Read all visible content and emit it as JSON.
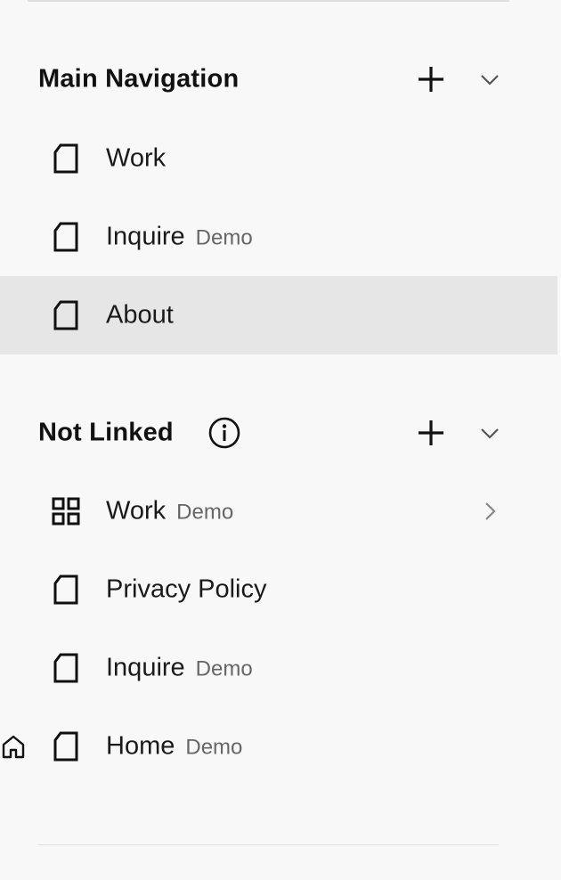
{
  "main_nav": {
    "title": "Main Navigation",
    "items": [
      {
        "label": "Work",
        "badge": ""
      },
      {
        "label": "Inquire",
        "badge": "Demo"
      },
      {
        "label": "About",
        "badge": ""
      }
    ],
    "selected_item": "About"
  },
  "not_linked": {
    "title": "Not Linked",
    "items": [
      {
        "label": "Work",
        "badge": "Demo",
        "icon": "grid-icon"
      },
      {
        "label": "Privacy Policy",
        "badge": "",
        "icon": "page-icon"
      },
      {
        "label": "Inquire",
        "badge": "Demo",
        "icon": "page-icon"
      },
      {
        "label": "Home",
        "badge": "Demo",
        "icon": "page-icon"
      }
    ]
  },
  "icons": {
    "add": "plus-icon",
    "collapse": "chevron-down-icon",
    "info": "info-icon",
    "page": "page-icon",
    "folder": "grid-icon",
    "expand": "chevron-right-icon",
    "homepage": "home-icon"
  },
  "colors": {
    "background": "#f8f8f8",
    "selected_row": "#e6e6e6",
    "text": "#1a1a1a",
    "badge_text": "#666666",
    "divider": "#dedede"
  }
}
